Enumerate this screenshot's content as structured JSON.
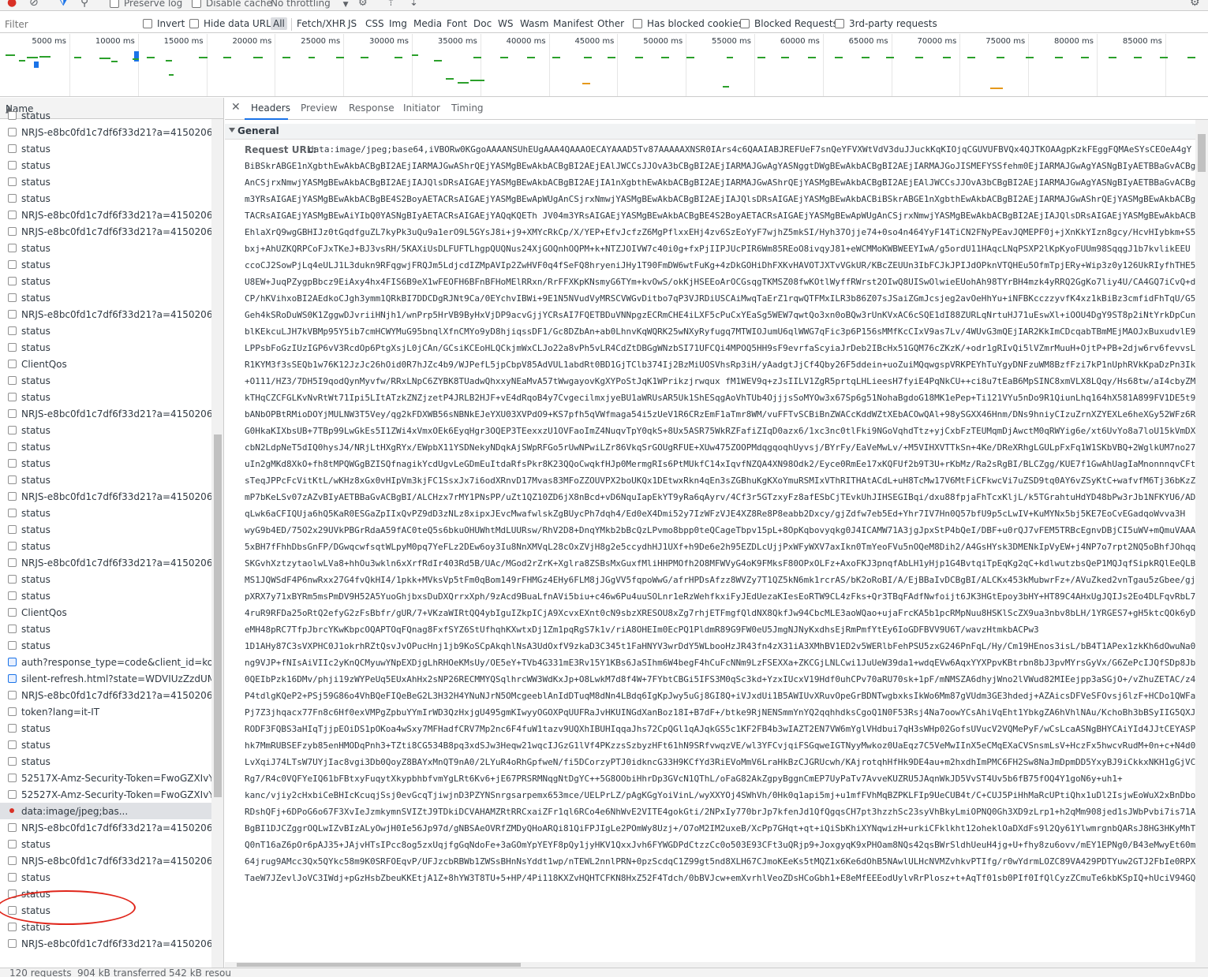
{
  "toolbar": {
    "preserve_log": "Preserve log",
    "disable_cache": "Disable cache",
    "throttling": "No throttling"
  },
  "filter": {
    "placeholder": "Filter",
    "invert": "Invert",
    "hide_data_urls": "Hide data URLs",
    "types": [
      "All",
      "Fetch/XHR",
      "JS",
      "CSS",
      "Img",
      "Media",
      "Font",
      "Doc",
      "WS",
      "Wasm",
      "Manifest",
      "Other"
    ],
    "has_blocked_cookies": "Has blocked cookies",
    "blocked_requests": "Blocked Requests",
    "third_party": "3rd-party requests"
  },
  "overview": {
    "ticks": [
      "5000 ms",
      "10000 ms",
      "15000 ms",
      "20000 ms",
      "25000 ms",
      "30000 ms",
      "35000 ms",
      "40000 ms",
      "45000 ms",
      "50000 ms",
      "55000 ms",
      "60000 ms",
      "65000 ms",
      "70000 ms",
      "75000 ms",
      "80000 ms",
      "85000 ms"
    ],
    "colors": {
      "green": "#2ba02b",
      "blue": "#1a73e8",
      "orange": "#e5981b"
    }
  },
  "list": {
    "header": "Name",
    "rows": [
      {
        "name": "status",
        "kind": "xhr"
      },
      {
        "name": "NRJS-e8bc0fd1c7df6f33d21?a=41502060&sa",
        "kind": "xhr"
      },
      {
        "name": "status",
        "kind": "xhr"
      },
      {
        "name": "status",
        "kind": "xhr"
      },
      {
        "name": "status",
        "kind": "xhr"
      },
      {
        "name": "status",
        "kind": "xhr"
      },
      {
        "name": "NRJS-e8bc0fd1c7df6f33d21?a=41502060&sa",
        "kind": "xhr"
      },
      {
        "name": "NRJS-e8bc0fd1c7df6f33d21?a=41502060&sa",
        "kind": "xhr"
      },
      {
        "name": "status",
        "kind": "xhr"
      },
      {
        "name": "status",
        "kind": "xhr"
      },
      {
        "name": "status",
        "kind": "xhr"
      },
      {
        "name": "status",
        "kind": "xhr"
      },
      {
        "name": "NRJS-e8bc0fd1c7df6f33d21?a=41502060&sa",
        "kind": "xhr"
      },
      {
        "name": "status",
        "kind": "xhr"
      },
      {
        "name": "status",
        "kind": "xhr"
      },
      {
        "name": "ClientQos",
        "kind": "xhr"
      },
      {
        "name": "status",
        "kind": "xhr"
      },
      {
        "name": "status",
        "kind": "xhr"
      },
      {
        "name": "NRJS-e8bc0fd1c7df6f33d21?a=41502060&sa",
        "kind": "xhr"
      },
      {
        "name": "status",
        "kind": "xhr"
      },
      {
        "name": "status",
        "kind": "xhr"
      },
      {
        "name": "status",
        "kind": "xhr"
      },
      {
        "name": "status",
        "kind": "xhr"
      },
      {
        "name": "NRJS-e8bc0fd1c7df6f33d21?a=41502060&sa",
        "kind": "xhr"
      },
      {
        "name": "status",
        "kind": "xhr"
      },
      {
        "name": "status",
        "kind": "xhr"
      },
      {
        "name": "status",
        "kind": "xhr"
      },
      {
        "name": "NRJS-e8bc0fd1c7df6f33d21?a=41502060&sa",
        "kind": "xhr"
      },
      {
        "name": "status",
        "kind": "xhr"
      },
      {
        "name": "status",
        "kind": "xhr"
      },
      {
        "name": "ClientQos",
        "kind": "xhr"
      },
      {
        "name": "status",
        "kind": "xhr"
      },
      {
        "name": "status",
        "kind": "xhr"
      },
      {
        "name": "auth?response_type=code&client_id=kong-id",
        "kind": "doc"
      },
      {
        "name": "silent-refresh.html?state=WDVIUzZzdUMtSkx",
        "kind": "doc"
      },
      {
        "name": "NRJS-e8bc0fd1c7df6f33d21?a=41502060&sa",
        "kind": "xhr"
      },
      {
        "name": "token?lang=it-IT",
        "kind": "xhr"
      },
      {
        "name": "status",
        "kind": "xhr"
      },
      {
        "name": "status",
        "kind": "xhr"
      },
      {
        "name": "status",
        "kind": "xhr"
      },
      {
        "name": "52517X-Amz-Security-Token=FwoGZXIvYXdzE",
        "kind": "xhr"
      },
      {
        "name": "52527X-Amz-Security-Token=FwoGZXIvYXdzE",
        "kind": "xhr"
      },
      {
        "name": "data:image/jpeg;bas...",
        "kind": "img",
        "selected": true
      },
      {
        "name": "NRJS-e8bc0fd1c7df6f33d21?a=41502060&sa",
        "kind": "xhr"
      },
      {
        "name": "status",
        "kind": "xhr"
      },
      {
        "name": "NRJS-e8bc0fd1c7df6f33d21?a=41502060&sa",
        "kind": "xhr"
      },
      {
        "name": "status",
        "kind": "xhr"
      },
      {
        "name": "status",
        "kind": "xhr"
      },
      {
        "name": "status",
        "kind": "xhr"
      },
      {
        "name": "status",
        "kind": "xhr"
      },
      {
        "name": "NRJS-e8bc0fd1c7df6f33d21?a=41502060&sa",
        "kind": "xhr"
      }
    ]
  },
  "status": {
    "requests": "120 requests",
    "transferred": "904 kB transferred",
    "resources": "542 kB resou"
  },
  "details": {
    "tabs": [
      "Headers",
      "Preview",
      "Response",
      "Initiator",
      "Timing"
    ],
    "section": "General",
    "request_url_label": "Request URL:",
    "request_url_first": "data:image/jpeg;base64,iVBORw0KGgoAAAANSUhEUgAAA4QAAAOECAYAAAD5Tv87AAAAAXNSR0IArs4c6QAAIABJREFUeF7snQeYFVXWtVdV3duJJuckKqKIOjqCGUVUFBVQx4QJTKOAAgpKzkFEggFQMAeSYsCEOeA4gY",
    "request_url_lines": [
      "BiBSkrABGE1nXgbthEwAkbACBgBI2AEjIARMAJGwAShrQEjYASMgBEwAkbACBgBI2AEjEAlJWCCsJJOvA3bCBgBI2AEjIARMAJGwAgYASNggtDWgBEwAkbACBgBI2AEjIARMAJGoJISMEFYSSfehm0EjIARMAJGwAgYASNgBIyAETBBaGvACBgBI",
      "AnCSjrxNmwjYASMgBEwAkbACBgBI2AEjIAJQlsDRsAIGAEjYASMgBEwAkbACBgBI2AEjIA1nXgbthEwAkbACBgBI2AEjIARMAJGwAShrQEjYASMgBEwAkbACBgBI2AEjEAlJWCCsJJOvA3bCBgBI2AEjIARMAJGwAgYASNgBIyAETBBaGvACBgBI",
      "m3YRsAIGAEjYASMgBEwAkbACBgBE4S2BoyAETACRsAIGAEjYASMgBEwApWUgAnCSjrxNmwjYASMgBEwAkbACBgBI2AEjIAJQlsDRsAIGAEjYASMgBEwAkbACBiBSkrABGE1nXgbthEwAkbACBgBI2AEjIARMAJGwAShrQEjYASMgBEwAkbACBgBI",
      "TACRsAIGAEjYASMgBEwAiYIbQ0YASNgBIyAETACRsAIGAEjYAQqKQETh JV04m3YRsAIGAEjYASMgBEwAkbACBgBE4S2BoyAETACRsAIGAEjYASMgBEwApWUgAnCSjrxNmwjYASMgBEwAkbACBgBI2AEjIAJQlsDRsAIGAEjYASMgBEwAkbACBiB",
      "EhlaXrQ9wgGBHIJz0tGqdfguZL7kyPk3uQu9a1erO9L5GYsJ8i+j9+XMYcRkCp/X/YEP+EfvJcfzZ6MgPflxxEHj4zv6SzEoYyF7wjhZ5mkSI/Hyh37Ojje74+0so4n464YyF14TiCN2FNyPEavJQMEPF0j+jXnKkYIzn8gcy/HcvHIybkm+S5F",
      "bxj+AhUZKQRPCoFJxTKeJ+BJ3vsRH/5KAXiUsDLFUFTLhgpQUQNus24XjGOQnhOQPM+k+NTZJOIVW7c40i0g+fxPjIIPJUcPIR6Wm85REoO8ivqyJ81+eWCMMoKWBWEEYIwA/g5ordU11HAqcLNqPSXP2lKpKyoFUUm98SqqgJ1b7kvlikEEU",
      "ccoCJ2SowPjLq4eULJ1L3dukn9RFqgwjFRQJm5LdjcdIZMpAVIp2ZwHVF0q4fSeFQ8hryeniJHy1T90FmDW6wtFuKg+4zDkGOHiDhFXKvHAVOTJXTvVGkUR/KBcZEUUn3IbFCJkJPIJdOPknVTQHEu5OfmTpjERy+Wip3z0y126UkRIyfhTHE5E",
      "U8EW+JuqPZygpBbcz9EiAxy4hx4FIS6B9eX1wFEOFH6BFnBFHoMElRRxn/RrFFXKpKNsmyG6TYm+kvOwS/okKjHSEEoArOCGsqgTKMSZ08fwKOtlWyffRWrst2OIwQ8UISwOlwieEUohAh98TYrBH4mzk4yRRQ2GgKo7liy4U/CA4GQ7iCvQ+dK",
      "CP/hKVihxoBI2AEdkoCJgh3ymm1QRkBI7DDCDgRJNt9Ca/0EYchvIBWi+9E1N5NVudVyMRSCVWGvDitbo7qP3VJRDiUSCAiMwqTaErZ1rqwQTFMxILR3b86Z07sJSaiZGmJcsjeg2avOeHhYu+iNFBKcczzyvfK4xz1kBiBz3cmfidFhTqU/G5C",
      "Geh4kSRoDuWS0K1ZggwDJvriiHNjh1/wnPrp5HrVB9ByHxVjDP9acvGjjYCRsAI7FQETBDuVNNpgzECRmCHE4iLXF5cPuCxYEaSg5WEW7qwtQo3xn0oBQw3rUnKVxAC6cSQE1dI88ZURLqNrtuHJ71uEswXl+iOOU4DgY9ST8p2iNtYrkDpCunC",
      "blKEkcuLJH7kVBMp95Y5ib7cmHCWYMuG95bnqlXfnCMYo9yD8hjiqssDF1/Gc8DZbAn+ab0LhnvKqWQRK25wNXyRyfugq7MTWIOJumU6qlWWG7qFic3p6P156sMMfKcCIxV9as7Lv/4WUvG3mQEjIAR2KkImCDcqabTBmMEjMAOJxBuxudvlE9",
      "LPPsbFoGzIUzIGP6vV3RcdOp6PtgXsjL0jCAn/GCsiKCEoHLQCkjmWxCLJo22a8vPh5vLR4CdZtDBGgWNzbSI71UFCQi4MPOQ5HH9sF9evrfaScyiaJrDeb2IBcHx51GQM76cZKzK/+odr1gRIvQi5lVZmrMuuH+OjtP+PB+2djw6rv6fevvsL",
      "R1KYM3f3sSEQb1w76K12JzJc26hOid0R7hJZc4b9/WJPefL5jpCbpV85AdVUL1abdRt0BD1GjTClb374Ij2BzMiUOSVhsRp3iH/yAadgtJjCf4Qby26F5ddein+uoZuiMQqwgspVRKPEYhTuYgyDNFzuWM8BzfFzi7kP1nUphRVkKpaDzPn3Iku",
      "+O111/HZ3/7DH5I9qodQynMyvfw/RRxLNpC6ZYBK8TUadwQhxxyNEaMvA57tWwgayovKgXYPoStJqK1WPrikzjrwqux fM1WEV9q+zJsIILV1ZgR5prtqLHLieesH7fyiE4PqNkCU++ci8u7tEaB6MpSINC8xmVLX8LQqy/Hs68tw/aI4cbyZMNV",
      "kTHqCZCFGLKvNvRtWt71Ipi5LItATzkZNZjzetP4JRLB2HJF+vE4dRqoB4y7CvgecilmxjyeBU1aWRUsAR5Uk1ShESqgAoVhTUb4OjjjsSoMYOw3x67Sp6g51NohaBgdoG18MK1ePep+Ti121VYu5nDo9R1QiunLhq164hX581A899FV1DE5t9",
      "bANbOPBtRMioDOYjMULNW3T5Vey/qg2kFDXWB56sNBNkEJeYXU03XVPdO9+KS7pfh5qVWfmaga54i5zUeV1R6CRzEmF1aTmr8WM/vuFFTvSCBiBnZWACcKddWZtXEbACOwQAl+98ySGXX46Hnm/DNs9hniyCIzuZrnXZYEXLe6heXGy52WFz6RJ",
      "G0HkaKIXbsUB+7TBp99LwGkEs5I1ZWi4xVmxOEk6EyqHgr3OQEP3TEexxzU1OVFaoImZ4NuqvTpY0qkS+8Ux5ASR75WkRZFafiZIqD0azx6/1xc3nc0tlFki9NGoVqhdTtz+yjCxbFzTEUMqmDjAwctM0qRWYig6e/xt6UvYo8a7loU15kVmDX4",
      "cbN2LdpNeT5dIQ0hysJ4/NRjLtHXgRYx/EWpbX11YSDNekyNDqkAjSWpRFGo5rUwNPwiLZr86VkqSrGOUgRFUE+XUw475ZOOPMdqgqoqhUyvsj/BYrFy/EaVeMwLv/+M5VIHXVTTkSn+4Ke/DReXRhgLGULpFxFq1W1SKbVBQ+2WglkUM7no27",
      "uIn2gMKd8XkO+fh8tMPQWGgBZISQfnagikYcdUgvLeGDmEuItdaRfsPkr8K23QQoCwqkfHJp0MermgRIs6PtMUkfC14xIqvfNZQA4XN98Odk2/Eyce0RmEe17xKQFUf2b9T3U+rKbMz/Ra2sRgBI/BLCZgg/KUE7f1GwAhUagIaMnonnnqvCFtE",
      "sTeqJPPcFcVitKtL/wKHz8xGx0vHIpVm3kjFC1SsxJx7i6odXRnvD17Mvas83MFoZZOUVPX2boUKQx1DEtwxRkn4qEn3sZGBhuKgKXoYmuRSMIxVThRITHAtACdL+uH8TcMw17V6MtFiCFkwcVi7uZSD9tq0AY6vZSyKtC+wafvfM6Tj36bKzZ",
      "mP7bKeLSv07zAZvBIyAETBBaGvACBgBI/ALCHzx7rMY1PNsPP/uZt1QZ10ZD6jX8nBcd+vD6NquIapEkYT9yRa6qAyrv/4Cf3r5GTzxyFz8afESbCjTEvkUhJIHSEGIBqi/dxu88fpjaFhTcxKljL/k5TGrahtuHdYD48bPw3rJb1NFKYU6/ADG",
      "qLwk6aCFIQUja6hQ5KaR0ESGaZpIIxQvPZ9dD3zNLz8xipxJEvcMwafwlskZgBUycPh7dqh4/Ed0eX4Dmi52y7IzWFzVJE4XZ8Re8P8eabb2Dxcy/gjZdfw7eb5Ed+Yhr7IV7Hn0Q57bfU9p5cLwIV+KuMYNx5bj5KE7EoCvEGadqoWvva3H",
      "wyG9b4ED/75O2x29UVkPBGrRdaA59fAC0teQ5s6bkuOHUWhtMdLUURsw/RhV2D8+DnqYMkb2bBcQzLPvmo8bpp0teQCageTbpv15pL+8OpKqbovyqkg0J4ICAMW71A3jgJpxStP4bQeI/DBF+u0rQJ7vFEM5TRBcEgnvDBjCI5uWV+mQmuVAAAg",
      "5xBH7fFhhDbsGnFP/DGwqcwfsqtWLpyM0pq7YeFLz2DEw6oy3Iu8NnXMVqL28cOxZVjH8g2e5ccydhHJ1UXf+h9De6e2h95EZDLcUjjPxWFyWXV7axIkn0TmYeoFVu5nOQeM8Dih2/A4GsHYsk3DMENkIpVyEW+j4NP7o7rpt2NQ5oBhfJOhqqr",
      "SKGvhXztzytaolwLVa8+hhOu3wkln6xXrfRdIr403Rd5B/UAc/MGod2rZrK+Xglra8ZSBsMxGuxfMliHHPMOfh2O8MFWVyG4oK9FMksF80OPxOLFz+AxoFKJ3pnqfAbLH1yHjp1G4BvtqiTpEqKg2qC+kdlwutzbsQeP1MQJqfSipkRQlEeQLBJ",
      "MS1JQWSdF4P6nwRxx27G4fvQkHI4/1pkk+MVksVp5tFm0qBom149rFHMGz4EHy6FLM8jJGgVV5fqpoWwG/afrHPDsAfzz8WVZy7T1QZ5kN6mk1rcrAS/bK2oRoBI/A/EjBBaIvDCBgBI/ALCKx453kMubwrFz+/AVuZked2vnTgau5zGbee/gjQ",
      "pXRX7y71xBYRm5msPmDV9H52A5YuoGhjbxsDuDXQrrxXph/9zAcd9BuaLfnAVi5biu+c46w6Pu4uuSOLnr1eRzWehfkxiFyJEdUezaKIesEoRTW9CL4zFks+Qr3TBqFAdfNwfoijt6JK3HGtEpoy3bHY+HT89C4AHxUgJQIJs2Eo4DLFqvRbL7y",
      "4ruR9RFDa25oRtQ2efyG2zFsBbfr/gUR/7+VKzaWIRtQQ4ybIguIZkpICjA9XcvxEXnt0cN9sbzXRESOU8xZg7rhjETFmgfQldNX8QkfJw94CbcMLE3aoWQao+ujaFrcKA5b1pcRMpNuu8HSKlScZX9ua3nbv8bLH/1YRGES7+gH5ktcQOk6yDs",
      "eMH48pRC7TfpJbrcYKwKbpcOQAPTOqFQnag8FxfSYZ6StUfhqhKXwtxDj1Zm1pqRgS7k1v/riA8OHEIm0EcPQ1PldmR89G9FW0eU5JmgNJNyKxdhsEjRmPmfYtEy6IoGDFBVV9U6T/wavzHtmkbACPw3",
      "1D1AHy87C3sVXPHC0J1okrhRZtQsvJvOPucHnj1jb9KoSCpAkqhlNsA3UdOxfV9zkaD3C345t1FaHNYV3wrDdY5WLbooHzJR43fn4zX31iA3XMhBV1ED2v5WERlbFehPSU5zxG246PnFqL/Hy/Cm19HEnos3isL/bB4T1APex1zkKh6dOwuNa0Nam",
      "ng9VJP+fNIsAiVIIc2yKnQCMyuwYNpEXDjgLhRHOeKMsUy/OE5eY+TVb4G331mE3Rv15Y1KBs6JaSIhm6W4begF4hCuFcNNm9LzFSEXXa+ZKCGjLNLCwi1JuUeW39da1+wdqEVw6AqxYYXPpvKBtrbn8bJ3pvMYrsGyVx/G6ZePcIJQfSDp8JbT",
      "0QEIbPzk16DMv/phji19zWYPeUq5EUxAhHx2sNP26RECMMYQSqlhrcWW3WdKxJp+O8LwkM7d8f4W+7FYbtCBGi5IFS3M0qSc3kd+YzxIUcxV19Hdf0uhCPv70aRU70sk+1pF/mNMSZA6dhyjWno2lVWud82MIEejpp3aSGjO+/vZhuZETAC/z4B",
      "P4tdlgKQeP2+PSj59G86o4VhBQeFIQeBeG2L3H32H4YNuNJrN5OMcgeeblAnIdDTuqM8dNn4LBdq6IgKpJwy5uGj8GI8Q+iVJxdUi1B5AWIUvXRuvOpeGrBDNTwgbxksIkWo6Mm87gVUdm3GE3hdedj+AZAicsDFVeSFOvsj6lzF+HCDo1QWFaG",
      "Pj7Z3jhqacx77Fn8c6Hf0exVMPgZpbuYYmIrWD3QzHxjgU495gmKIwyyOGOXPqUUFRaJvHKUINGdXanBoz18I+B7dF+/btke9RjNENSmmYnYQ2qqhhdksCgoQ1N0F53Rsj4Na7oowYCsAhiVqEht1YbkgZA6hVhlNAu/KchoBh3bBSyIIG5QXJ",
      "RODF3FQBS3aHIqTjjpEOiDS1pOKoa4wSxy7MFHadfCRV7Mp2nc6F4fuW1tazv9UQXhIBUHIqqaJhs72CpQGl1qAJqkGS5c1KF2FB4b3wIAZT2EN7VW6mYglVHdbui7qH3sWHp02GofsUVucV2VQMePyF/wCsLcaASNgBHYCAiYId4JJtCEYASPw",
      "hk7MmRUBSEFzyb85enHMODqPnh3+TZti8CG534B8pq3xdSJw3Heqw21wqcIJGzG1lVf4PKzzsSzbyzHFt61hN9SRfvwqzVE/wl3YFCvjqiFSGqweIGTNyyMwkoz0UaEqz7C5VeMwIInX5eCMqEXaCVSnsmLsV+HczFx5hwcvRudM+0n+c+N4d0",
      "LvXqiJ74LTsW7UYjIac8vgi3Db0QoyZ8BAYxMnQT9nA0/2LYuR4oRhGpfweN/fi5DCorzyPTJ0idkncG33H9KCfYd3RiEVoMmV6LraHkBzCJGRUcwh/KAjrotqhHfHk9DE4au+m2hxdhImPMC6FH2Sw8NaJmDpmDD5YxyBJ9iCkkxNKH1gGjVCy",
      "Rg7/R4c0VQFYeIQ61bFBtxyFuqytXkypbhbfvmYgLRt6Kv6+jE67PRSRMNqgNtDgYC++5G8OObiHhrDp3GVcN1QThL/oFaG82AkZgpyBggnCmEP7UyPaTv7AvveKUZRU5JAqnWkJD5VvST4Uv5b6fB75fOQ4Y1goN6y+uh1+",
      "kanc/vjiy2cHxbiCeBHIcKcuqjSsj0evGcqTjiwjnD3PZYNSnrgsarpemx653mce/UELPrLZ/pAgKGgYoiVinL/wyXXYOj4SWhVh/0Hk0q1api5mj+u1mfFVhMqBZPKLFIp9UeCUB4t/C+CUJ5PiHhMaRcUPtiQhx1uDl2IsjwEoWuX2xBnDbo1",
      "RDshQFj+6DPoG6o67F3XvIeJzmkymnSVIZtJ9TDkiDCVAHAMZRtRRCxaiZFr1ql6RCo4e6NhWvE2VITE4gokGti/2NPxIy770brJp7kfenJd1QfQgqsCH7pt3hzzhSc23syVhBkyLmiOPNQ0Gh3XD9zLrp1+h2qMm908jed1sJWbPvbi7is71A8",
      "BgBI1DJCZggrOQLwIZvBIzALyOwjH0Ie56Jp97d/gNBSAeOVRfZMDyQHoARQi81QiFPJIgLe2POmWy8Uzj+/O7oM2IM2uxeB/XcPp7GHqt+qt+iQiSbKhiXYNqwizH+urkiCFklkht12oheklOaDXdFs9l2Qy61YlwmrgnbQARsJ8HG3HKyMhT7",
      "Q0nT16aZ6pOr6pAJ35+JAjvHTsIPcc8og5zxUqjfgGqNdoFe+3aGOmYpYEYF8pQy1jyHKV1QxxJvh6FYWGDPdCtzzCc0o503E93CFt3uQRjp9+JoxgyqK9xPHOam8NQs42qsBWrSldhUeuH4jg+U+fhy8zu6ovv/mEY1EPNg0/B43eMwyEt60mu",
      "64jrug9AMcc3Qx5QYkc58m9K0SRFOEqvP/UFJzcbRBWb1ZWSsBHnNsYddt1wp/nTEWL2nnlPRN+0pzScdqC1Z99gt5nd8XLH67CJmoKEeKs5tMQZ1x6Ke6dOhB5NAwlULHcNVMZvhkvPTIfg/r0wYdrmLOZC89VA429PDTYuw2GTJ2FbIe0RPXg",
      "TaeW7JZevlJoVC3IWdj+pGzHsbZbeuKKEtjA1Z+8hYW3T8TU+5+HP/4Pi118KXZvHQHTCFKN8HxZ52F4Tdch/0bBVJcw+emXvrhlVeoZDsHCoGbh1+E8eMfEEEodUylvRrPlosz+t+AqTf01sb0PIf0IfQlCyzZCmuTe6kbKSpIQ+hUciV94GQ7"
    ]
  }
}
